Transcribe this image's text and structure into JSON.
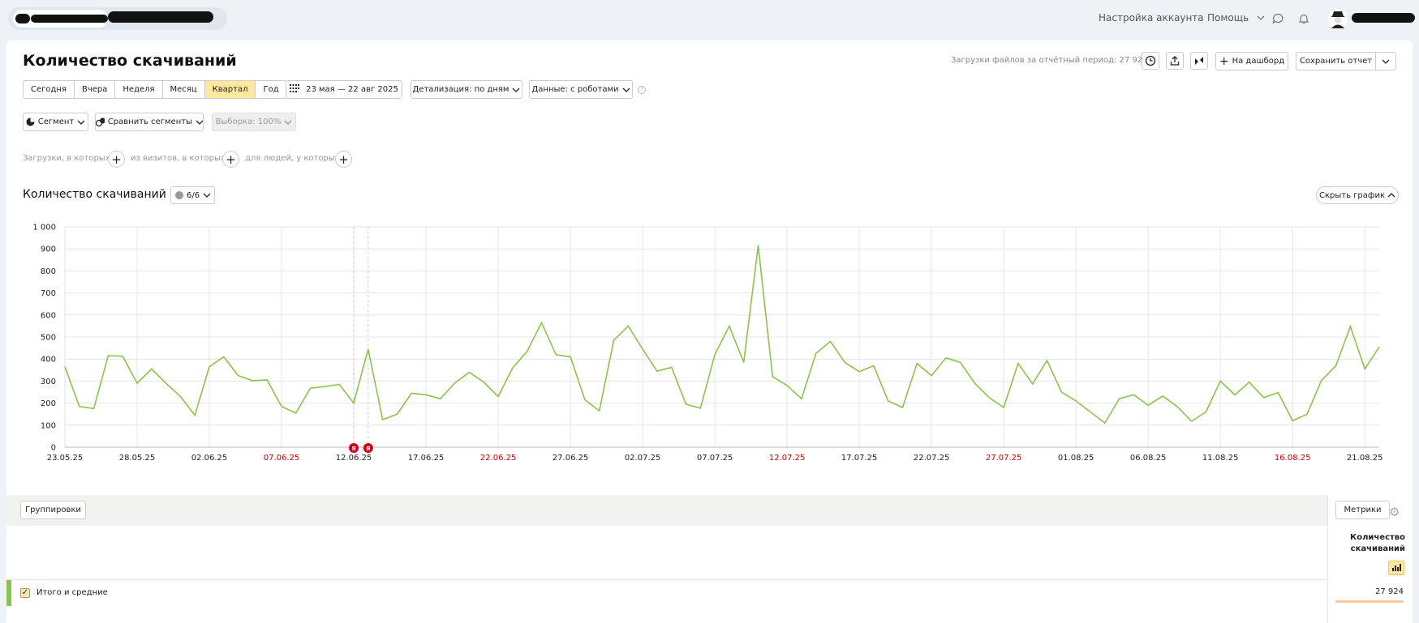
{
  "header": {
    "account_settings": "Настройка аккаунта",
    "help": "Помощь"
  },
  "report": {
    "title": "Количество скачиваний",
    "period_info": "Загрузки файлов за отчётный период: 27 924",
    "to_dashboard": "На дашборд",
    "save_report": "Сохранить отчет"
  },
  "periods": [
    "Сегодня",
    "Вчера",
    "Неделя",
    "Месяц",
    "Квартал",
    "Год"
  ],
  "active_period": "Квартал",
  "date_range": "23 мая — 22 авг 2025",
  "detail": "Детализация: по дням",
  "data_source": "Данные: с роботами",
  "segment": "Сегмент",
  "compare_segments": "Сравнить сегменты",
  "sample": "Выборка: 100%",
  "filters": {
    "downloads": "Загрузки, в которых",
    "visits": "из визитов, в которых",
    "people": "для людей, у которых"
  },
  "chart_block": {
    "title": "Количество скачиваний",
    "series_counter": "6/6",
    "hide_chart": "Скрыть график"
  },
  "table": {
    "groupings": "Группировки",
    "metrics": "Метрики",
    "metric_header": "Количество скачиваний",
    "total_label": "Итого и средние",
    "total_value": "27 924"
  },
  "colors": {
    "line": "#8bc34a",
    "accent": "#fde89d",
    "weekend_tick": "#cc0000"
  },
  "chart_data": {
    "type": "line",
    "title": "",
    "ylim": [
      0,
      1000
    ],
    "yticks": [
      "0",
      "100",
      "200",
      "300",
      "400",
      "500",
      "600",
      "700",
      "800",
      "900",
      "1 000"
    ],
    "xticks": [
      {
        "label": "23.05.25",
        "index": 0,
        "weekend": false
      },
      {
        "label": "28.05.25",
        "index": 5,
        "weekend": false
      },
      {
        "label": "02.06.25",
        "index": 10,
        "weekend": false
      },
      {
        "label": "07.06.25",
        "index": 15,
        "weekend": true
      },
      {
        "label": "12.06.25",
        "index": 20,
        "weekend": false
      },
      {
        "label": "17.06.25",
        "index": 25,
        "weekend": false
      },
      {
        "label": "22.06.25",
        "index": 30,
        "weekend": true
      },
      {
        "label": "27.06.25",
        "index": 35,
        "weekend": false
      },
      {
        "label": "02.07.25",
        "index": 40,
        "weekend": false
      },
      {
        "label": "07.07.25",
        "index": 45,
        "weekend": false
      },
      {
        "label": "12.07.25",
        "index": 50,
        "weekend": true
      },
      {
        "label": "17.07.25",
        "index": 55,
        "weekend": false
      },
      {
        "label": "22.07.25",
        "index": 60,
        "weekend": false
      },
      {
        "label": "27.07.25",
        "index": 65,
        "weekend": true
      },
      {
        "label": "01.08.25",
        "index": 70,
        "weekend": false
      },
      {
        "label": "06.08.25",
        "index": 75,
        "weekend": false
      },
      {
        "label": "11.08.25",
        "index": 80,
        "weekend": false
      },
      {
        "label": "16.08.25",
        "index": 85,
        "weekend": true
      },
      {
        "label": "21.08.25",
        "index": 90,
        "weekend": false
      }
    ],
    "annotations": [
      {
        "index": 20,
        "label": "Я"
      },
      {
        "index": 21,
        "label": "Я"
      }
    ],
    "grid": true,
    "series": [
      {
        "values": [
          365,
          185,
          175,
          415,
          413,
          290,
          355,
          290,
          230,
          145,
          365,
          410,
          325,
          302,
          305,
          185,
          155,
          268,
          275,
          285,
          200,
          445,
          125,
          150,
          245,
          238,
          220,
          292,
          340,
          295,
          230,
          360,
          435,
          565,
          420,
          410,
          215,
          165,
          485,
          550,
          445,
          345,
          363,
          195,
          177,
          420,
          550,
          385,
          915,
          320,
          280,
          220,
          425,
          480,
          385,
          343,
          370,
          210,
          180,
          380,
          325,
          405,
          385,
          290,
          225,
          180,
          380,
          287,
          393,
          250,
          210,
          160,
          110,
          220,
          238,
          190,
          232,
          185,
          118,
          160,
          300,
          237,
          295,
          225,
          248,
          120,
          150,
          303,
          370,
          548,
          355,
          455
        ]
      }
    ]
  }
}
